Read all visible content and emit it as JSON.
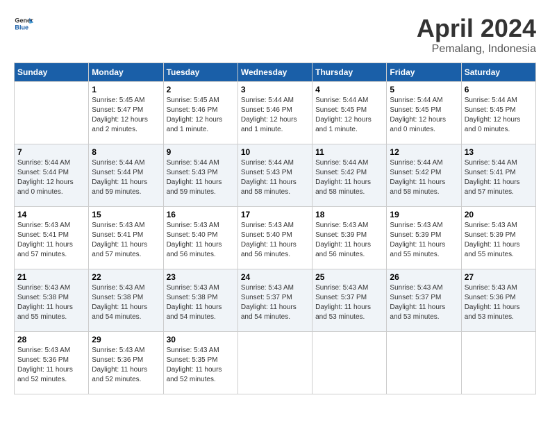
{
  "header": {
    "logo_general": "General",
    "logo_blue": "Blue",
    "month_title": "April 2024",
    "location": "Pemalang, Indonesia"
  },
  "weekdays": [
    "Sunday",
    "Monday",
    "Tuesday",
    "Wednesday",
    "Thursday",
    "Friday",
    "Saturday"
  ],
  "weeks": [
    [
      {
        "day": "",
        "sunrise": "",
        "sunset": "",
        "daylight": ""
      },
      {
        "day": "1",
        "sunrise": "Sunrise: 5:45 AM",
        "sunset": "Sunset: 5:47 PM",
        "daylight": "Daylight: 12 hours and 2 minutes."
      },
      {
        "day": "2",
        "sunrise": "Sunrise: 5:45 AM",
        "sunset": "Sunset: 5:46 PM",
        "daylight": "Daylight: 12 hours and 1 minute."
      },
      {
        "day": "3",
        "sunrise": "Sunrise: 5:44 AM",
        "sunset": "Sunset: 5:46 PM",
        "daylight": "Daylight: 12 hours and 1 minute."
      },
      {
        "day": "4",
        "sunrise": "Sunrise: 5:44 AM",
        "sunset": "Sunset: 5:45 PM",
        "daylight": "Daylight: 12 hours and 1 minute."
      },
      {
        "day": "5",
        "sunrise": "Sunrise: 5:44 AM",
        "sunset": "Sunset: 5:45 PM",
        "daylight": "Daylight: 12 hours and 0 minutes."
      },
      {
        "day": "6",
        "sunrise": "Sunrise: 5:44 AM",
        "sunset": "Sunset: 5:45 PM",
        "daylight": "Daylight: 12 hours and 0 minutes."
      }
    ],
    [
      {
        "day": "7",
        "sunrise": "Sunrise: 5:44 AM",
        "sunset": "Sunset: 5:44 PM",
        "daylight": "Daylight: 12 hours and 0 minutes."
      },
      {
        "day": "8",
        "sunrise": "Sunrise: 5:44 AM",
        "sunset": "Sunset: 5:44 PM",
        "daylight": "Daylight: 11 hours and 59 minutes."
      },
      {
        "day": "9",
        "sunrise": "Sunrise: 5:44 AM",
        "sunset": "Sunset: 5:43 PM",
        "daylight": "Daylight: 11 hours and 59 minutes."
      },
      {
        "day": "10",
        "sunrise": "Sunrise: 5:44 AM",
        "sunset": "Sunset: 5:43 PM",
        "daylight": "Daylight: 11 hours and 58 minutes."
      },
      {
        "day": "11",
        "sunrise": "Sunrise: 5:44 AM",
        "sunset": "Sunset: 5:42 PM",
        "daylight": "Daylight: 11 hours and 58 minutes."
      },
      {
        "day": "12",
        "sunrise": "Sunrise: 5:44 AM",
        "sunset": "Sunset: 5:42 PM",
        "daylight": "Daylight: 11 hours and 58 minutes."
      },
      {
        "day": "13",
        "sunrise": "Sunrise: 5:44 AM",
        "sunset": "Sunset: 5:41 PM",
        "daylight": "Daylight: 11 hours and 57 minutes."
      }
    ],
    [
      {
        "day": "14",
        "sunrise": "Sunrise: 5:43 AM",
        "sunset": "Sunset: 5:41 PM",
        "daylight": "Daylight: 11 hours and 57 minutes."
      },
      {
        "day": "15",
        "sunrise": "Sunrise: 5:43 AM",
        "sunset": "Sunset: 5:41 PM",
        "daylight": "Daylight: 11 hours and 57 minutes."
      },
      {
        "day": "16",
        "sunrise": "Sunrise: 5:43 AM",
        "sunset": "Sunset: 5:40 PM",
        "daylight": "Daylight: 11 hours and 56 minutes."
      },
      {
        "day": "17",
        "sunrise": "Sunrise: 5:43 AM",
        "sunset": "Sunset: 5:40 PM",
        "daylight": "Daylight: 11 hours and 56 minutes."
      },
      {
        "day": "18",
        "sunrise": "Sunrise: 5:43 AM",
        "sunset": "Sunset: 5:39 PM",
        "daylight": "Daylight: 11 hours and 56 minutes."
      },
      {
        "day": "19",
        "sunrise": "Sunrise: 5:43 AM",
        "sunset": "Sunset: 5:39 PM",
        "daylight": "Daylight: 11 hours and 55 minutes."
      },
      {
        "day": "20",
        "sunrise": "Sunrise: 5:43 AM",
        "sunset": "Sunset: 5:39 PM",
        "daylight": "Daylight: 11 hours and 55 minutes."
      }
    ],
    [
      {
        "day": "21",
        "sunrise": "Sunrise: 5:43 AM",
        "sunset": "Sunset: 5:38 PM",
        "daylight": "Daylight: 11 hours and 55 minutes."
      },
      {
        "day": "22",
        "sunrise": "Sunrise: 5:43 AM",
        "sunset": "Sunset: 5:38 PM",
        "daylight": "Daylight: 11 hours and 54 minutes."
      },
      {
        "day": "23",
        "sunrise": "Sunrise: 5:43 AM",
        "sunset": "Sunset: 5:38 PM",
        "daylight": "Daylight: 11 hours and 54 minutes."
      },
      {
        "day": "24",
        "sunrise": "Sunrise: 5:43 AM",
        "sunset": "Sunset: 5:37 PM",
        "daylight": "Daylight: 11 hours and 54 minutes."
      },
      {
        "day": "25",
        "sunrise": "Sunrise: 5:43 AM",
        "sunset": "Sunset: 5:37 PM",
        "daylight": "Daylight: 11 hours and 53 minutes."
      },
      {
        "day": "26",
        "sunrise": "Sunrise: 5:43 AM",
        "sunset": "Sunset: 5:37 PM",
        "daylight": "Daylight: 11 hours and 53 minutes."
      },
      {
        "day": "27",
        "sunrise": "Sunrise: 5:43 AM",
        "sunset": "Sunset: 5:36 PM",
        "daylight": "Daylight: 11 hours and 53 minutes."
      }
    ],
    [
      {
        "day": "28",
        "sunrise": "Sunrise: 5:43 AM",
        "sunset": "Sunset: 5:36 PM",
        "daylight": "Daylight: 11 hours and 52 minutes."
      },
      {
        "day": "29",
        "sunrise": "Sunrise: 5:43 AM",
        "sunset": "Sunset: 5:36 PM",
        "daylight": "Daylight: 11 hours and 52 minutes."
      },
      {
        "day": "30",
        "sunrise": "Sunrise: 5:43 AM",
        "sunset": "Sunset: 5:35 PM",
        "daylight": "Daylight: 11 hours and 52 minutes."
      },
      {
        "day": "",
        "sunrise": "",
        "sunset": "",
        "daylight": ""
      },
      {
        "day": "",
        "sunrise": "",
        "sunset": "",
        "daylight": ""
      },
      {
        "day": "",
        "sunrise": "",
        "sunset": "",
        "daylight": ""
      },
      {
        "day": "",
        "sunrise": "",
        "sunset": "",
        "daylight": ""
      }
    ]
  ]
}
